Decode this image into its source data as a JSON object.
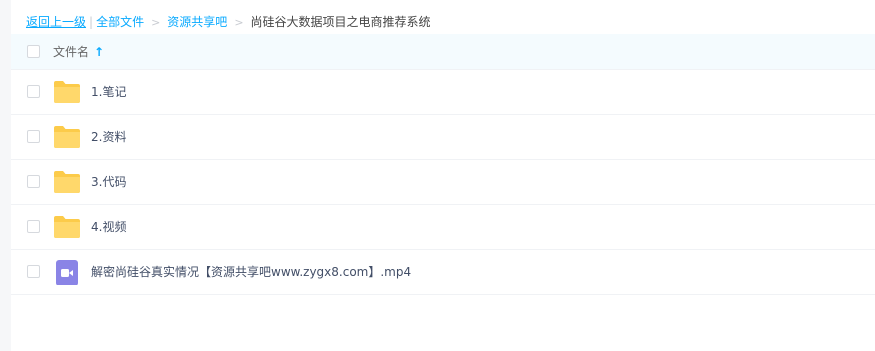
{
  "breadcrumb": {
    "back": "返回上一级",
    "divider": "|",
    "items": [
      "全部文件",
      "资源共享吧",
      "尚硅谷大数据项目之电商推荐系统"
    ],
    "separator": ">"
  },
  "table_header": {
    "name_label": "文件名",
    "sort_icon": "sort-ascending-icon",
    "sort_glyph": "↑"
  },
  "files": [
    {
      "name": "1.笔记",
      "type": "folder",
      "icon": "folder-icon"
    },
    {
      "name": "2.资料",
      "type": "folder",
      "icon": "folder-icon"
    },
    {
      "name": "3.代码",
      "type": "folder",
      "icon": "folder-icon"
    },
    {
      "name": "4.视频",
      "type": "folder",
      "icon": "folder-icon"
    },
    {
      "name": "解密尚硅谷真实情况【资源共享吧www.zygx8.com】.mp4",
      "type": "video",
      "icon": "video-file-icon"
    }
  ],
  "colors": {
    "link": "#09aaff",
    "folder": "#ffd86b",
    "video": "#8a84e6",
    "header_bg": "#f4fbfe"
  }
}
